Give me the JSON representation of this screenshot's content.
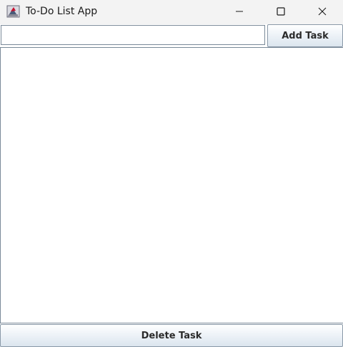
{
  "window": {
    "title": "To-Do List App",
    "icon": "java-app-icon",
    "controls": {
      "minimize_icon": "minimize-icon",
      "maximize_icon": "maximize-icon",
      "close_icon": "close-icon"
    }
  },
  "input_row": {
    "task_input_value": "",
    "add_button_label": "Add Task"
  },
  "task_list": {
    "items": []
  },
  "footer": {
    "delete_button_label": "Delete Task"
  },
  "colors": {
    "titlebar_bg": "#f3f3f3",
    "border": "#7a8a99",
    "button_gradient_top": "#ffffff",
    "button_gradient_bottom": "#dbe5ee",
    "button_text": "#2b2b2b"
  }
}
